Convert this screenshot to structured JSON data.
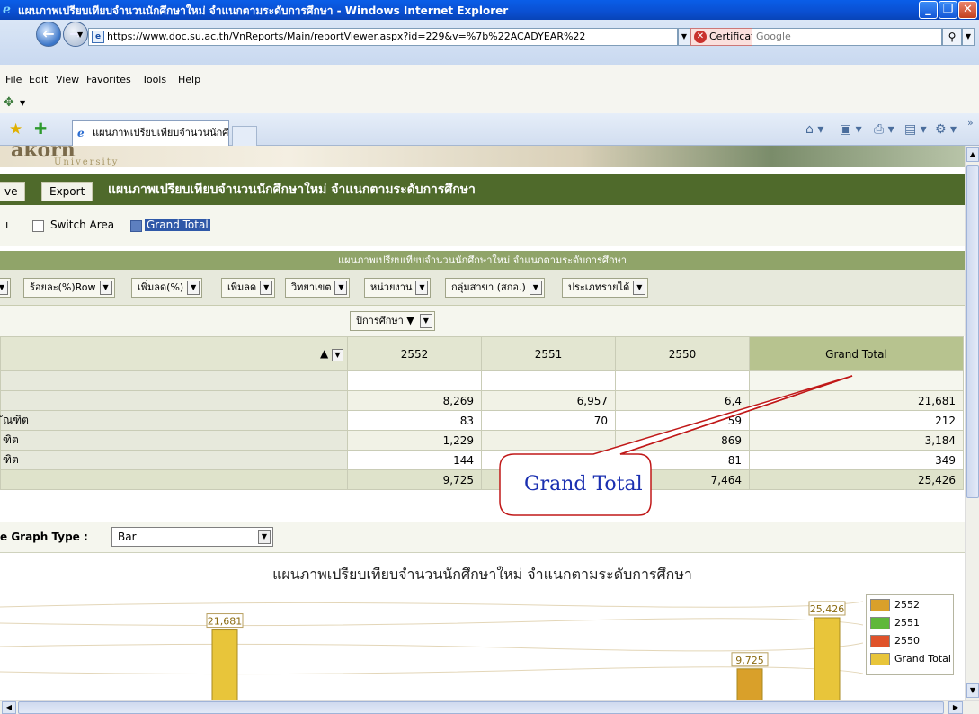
{
  "window": {
    "title": "แผนภาพเปรียบเทียบจำนวนนักศึกษาใหม่ จำแนกตามระดับการศึกษา - Windows Internet Explorer",
    "min": "_",
    "max": "❐",
    "close": "✕"
  },
  "address": {
    "url": "https://www.doc.su.ac.th/VnReports/Main/reportViewer.aspx?id=229&v=%7b%22ACADYEAR%22",
    "cert_error": "Certificate Error",
    "search_placeholder": "Google"
  },
  "menu": [
    "File",
    "Edit",
    "View",
    "Favorites",
    "Tools",
    "Help"
  ],
  "tab": {
    "label": "แผนภาพเปรียบเทียบจำนวนนักศึกษาใหม่ จำแนกตามระดั..."
  },
  "banner": {
    "text": "akorn",
    "sub": "University"
  },
  "report": {
    "save_label": "ve",
    "export_label": "Export",
    "title": "แผนภาพเปรียบเทียบจำนวนนักศึกษาใหม่ จำแนกตามระดับการศึกษา",
    "options": {
      "partial_label": "ı",
      "switch_area": "Switch Area",
      "grand_total": "Grand Total"
    },
    "table_title": "แผนภาพเปรียบเทียบจำนวนนักศึกษาใหม่ จำแนกตามระดับการศึกษา",
    "fields": [
      "ร้อยละ(%)Row",
      "เพิ่มลด(%)",
      "เพิ่มลด",
      "วิทยาเขต",
      "หน่วยงาน",
      "กลุ่มสาขา (สกอ.)",
      "ประเภทรายได้"
    ],
    "column_field": "ปีการศึกษา ▼",
    "columns": [
      "2552",
      "2551",
      "2550",
      "Grand Total"
    ],
    "rows": [
      {
        "label": "",
        "values": [
          "",
          "",
          "",
          ""
        ]
      },
      {
        "label": "",
        "values": [
          "8,269",
          "6,957",
          "6,4",
          "21,681"
        ]
      },
      {
        "label": "ัณฑิต",
        "values": [
          "83",
          "70",
          "59",
          "212"
        ]
      },
      {
        "label": "ฑิต",
        "values": [
          "1,229",
          "",
          "869",
          "3,184"
        ]
      },
      {
        "label": "ฑิต",
        "values": [
          "144",
          "",
          "81",
          "349"
        ]
      },
      {
        "label": "",
        "values": [
          "9,725",
          "",
          "7,464",
          "25,426"
        ]
      }
    ],
    "graph_type_label": "e Graph Type :",
    "graph_type_value": "Bar",
    "chart_title": "แผนภาพเปรียบเทียบจำนวนนักศึกษาใหม่ จำแนกตามระดับการศึกษา"
  },
  "callout": {
    "text": "Grand Total"
  },
  "chart_data": {
    "type": "bar",
    "title": "แผนภาพเปรียบเทียบจำนวนนักศึกษาใหม่ จำแนกตามระดับการศึกษา",
    "data_labels": [
      "21,681",
      "9,725",
      "25,426"
    ],
    "values": [
      21681,
      9725,
      25426
    ],
    "legend": [
      {
        "name": "2552",
        "color": "#d9a02a"
      },
      {
        "name": "2551",
        "color": "#5fb83a"
      },
      {
        "name": "2550",
        "color": "#e0532a"
      },
      {
        "name": "Grand Total",
        "color": "#e8c53a"
      }
    ],
    "legend_position": "right"
  }
}
